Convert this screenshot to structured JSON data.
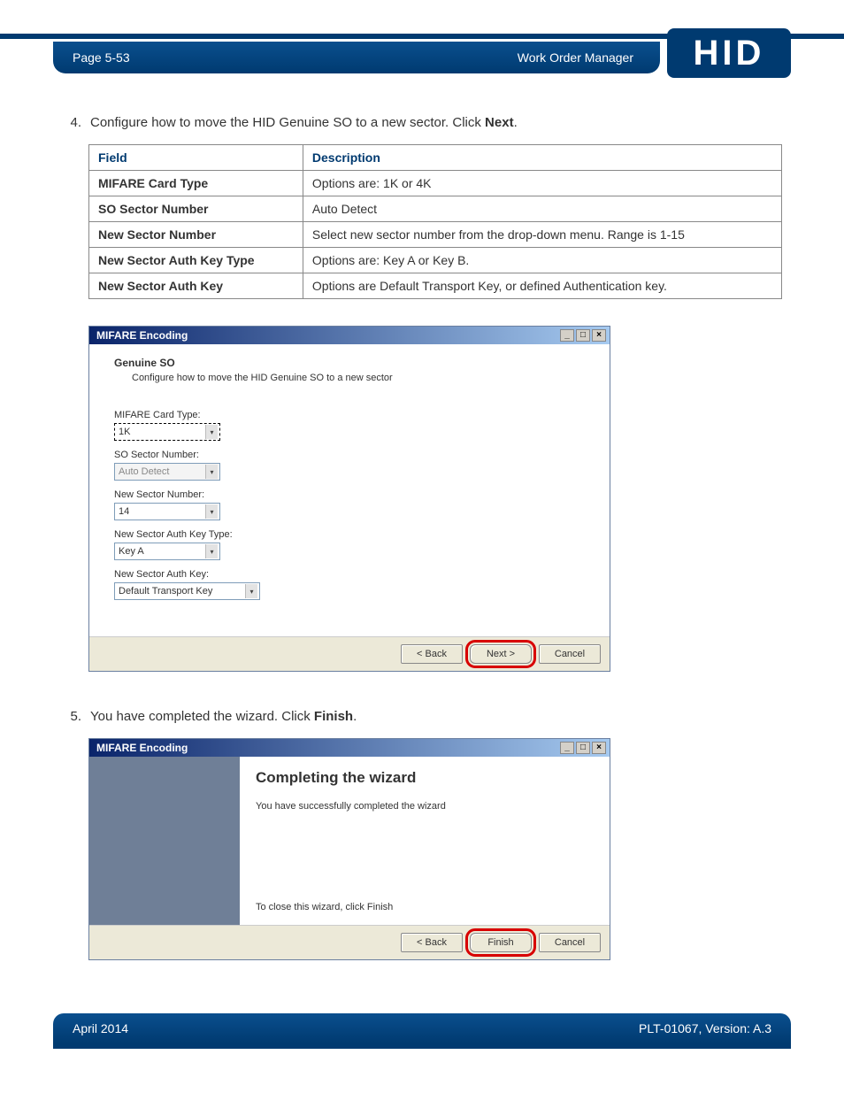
{
  "header": {
    "page_label": "Page 5-53",
    "section_title": "Work Order Manager",
    "logo_text": "HID"
  },
  "step4": {
    "num": "4.",
    "text_pre": "Configure how to move the HID Genuine SO to a new sector. Click ",
    "text_bold": "Next",
    "text_post": "."
  },
  "table": {
    "col_field": "Field",
    "col_desc": "Description",
    "rows": [
      {
        "field": "MIFARE Card Type",
        "desc": "Options are: 1K or 4K"
      },
      {
        "field": "SO Sector Number",
        "desc": "Auto Detect"
      },
      {
        "field": "New Sector Number",
        "desc": "Select new sector number from the drop-down menu. Range is 1-15"
      },
      {
        "field": "New Sector Auth Key Type",
        "desc": "Options are: Key A or Key B."
      },
      {
        "field": "New Sector Auth Key",
        "desc": "Options are Default Transport Key, or defined Authentication key."
      }
    ]
  },
  "dialog1": {
    "title": "MIFARE Encoding",
    "heading": "Genuine SO",
    "subtitle": "Configure how to move the HID Genuine SO to a new sector",
    "fields": {
      "card_type": {
        "label": "MIFARE Card Type:",
        "value": "1K"
      },
      "so_sector": {
        "label": "SO Sector Number:",
        "value": "Auto Detect"
      },
      "new_sector": {
        "label": "New Sector Number:",
        "value": "14"
      },
      "auth_type": {
        "label": "New Sector Auth Key Type:",
        "value": "Key A"
      },
      "auth_key": {
        "label": "New Sector Auth Key:",
        "value": "Default Transport Key"
      }
    },
    "buttons": {
      "back": "< Back",
      "next": "Next >",
      "cancel": "Cancel"
    }
  },
  "step5": {
    "num": "5.",
    "text_pre": "You have completed the wizard. Click ",
    "text_bold": "Finish",
    "text_post": "."
  },
  "dialog2": {
    "title": "MIFARE Encoding",
    "heading": "Completing the wizard",
    "message": "You have successfully completed the wizard",
    "close_msg": "To close this wizard, click Finish",
    "buttons": {
      "back": "< Back",
      "finish": "Finish",
      "cancel": "Cancel"
    }
  },
  "footer": {
    "date": "April 2014",
    "doc": "PLT-01067, Version: A.3"
  },
  "win_controls": {
    "min": "_",
    "max": "□",
    "close": "×"
  }
}
